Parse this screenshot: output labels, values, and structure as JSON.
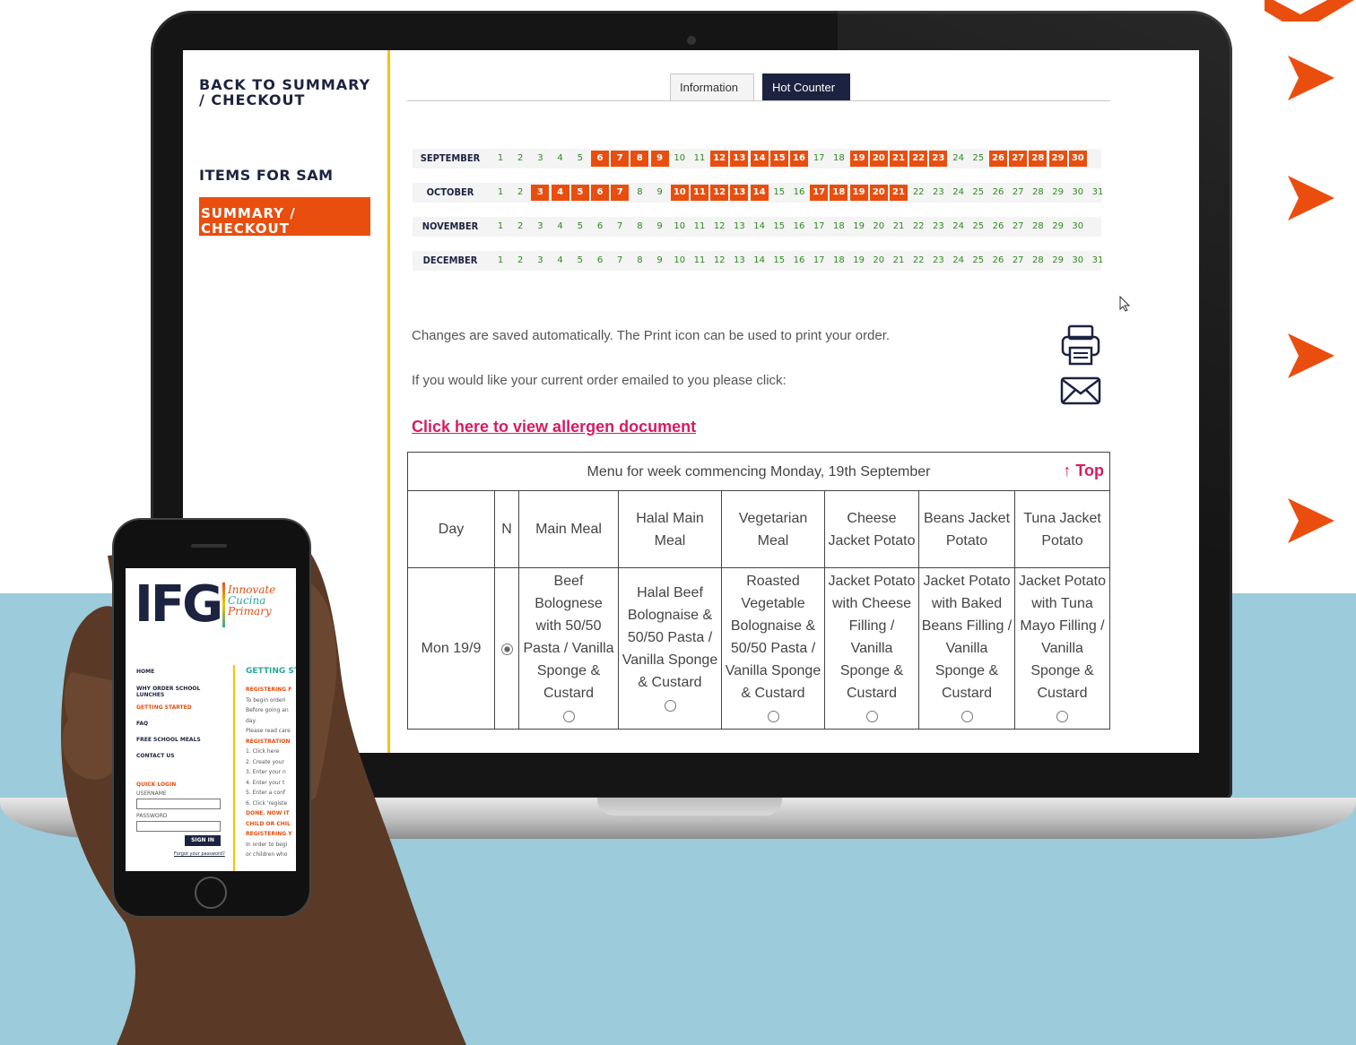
{
  "sidebar": {
    "back_link": "BACK TO SUMMARY / CHECKOUT",
    "items_title": "ITEMS FOR SAM",
    "summary_button": "SUMMARY / CHECKOUT"
  },
  "tabs": [
    {
      "label": "Information",
      "active": false
    },
    {
      "label": "Hot Counter",
      "active": true
    }
  ],
  "calendar": [
    {
      "month": "SEPTEMBER",
      "days": 30,
      "selected": [
        6,
        7,
        8,
        9,
        12,
        13,
        14,
        15,
        16,
        19,
        20,
        21,
        22,
        23,
        26,
        27,
        28,
        29,
        30
      ]
    },
    {
      "month": "OCTOBER",
      "days": 31,
      "selected": [
        3,
        4,
        5,
        6,
        7,
        10,
        11,
        12,
        13,
        14,
        17,
        18,
        19,
        20,
        21
      ]
    },
    {
      "month": "NOVEMBER",
      "days": 30,
      "selected": []
    },
    {
      "month": "DECEMBER",
      "days": 31,
      "selected": []
    }
  ],
  "info": {
    "saved_text": "Changes are saved automatically. The Print icon can be used to print your order.",
    "email_text": "If you would like your current order emailed to you please click:",
    "allergen_link": "Click here to view allergen document"
  },
  "menu": {
    "caption": "Menu for week commencing Monday, 19th September",
    "top_link": "↑ Top",
    "columns": [
      "Day",
      "N",
      "Main Meal",
      "Halal Main Meal",
      "Vegetarian Meal",
      "Cheese Jacket Potato",
      "Beans Jacket Potato",
      "Tuna Jacket Potato"
    ],
    "rows": [
      {
        "day": "Mon 19/9",
        "meals": [
          "Beef Bolognese with 50/50 Pasta / Vanilla Sponge & Custard",
          "Halal Beef Bolognaise & 50/50 Pasta / Vanilla Sponge & Custard",
          "Roasted Vegetable Bolognaise & 50/50 Pasta / Vanilla Sponge & Custard",
          "Jacket Potato with Cheese Filling / Vanilla Sponge & Custard",
          "Jacket Potato with Baked Beans Filling / Vanilla Sponge & Custard",
          "Jacket Potato with Tuna Mayo Filling / Vanilla Sponge & Custard"
        ]
      }
    ]
  },
  "phone": {
    "logo": "IFG",
    "tagline": [
      "Innovate",
      "Cucina",
      "Primary"
    ],
    "nav": [
      "HOME",
      "WHY ORDER SCHOOL LUNCHES",
      "GETTING STARTED",
      "FAQ",
      "FREE SCHOOL MEALS",
      "CONTACT US"
    ],
    "quick_login": "QUICK LOGIN",
    "username_label": "USERNAME",
    "password_label": "PASSWORD",
    "sign_in": "SIGN IN",
    "forgot": "Forgot your password?",
    "right_heading": "GETTING ST",
    "right_lines": [
      "REGISTERING F",
      "To begin orderi",
      "Before going an",
      "day.",
      "Please read care",
      "REGISTRATION",
      "1. Click here",
      "2. Create your",
      "3. Enter your n",
      "4. Enter your t",
      "5. Enter a conf",
      "6. Click 'registe",
      "DONE. NOW IT",
      "CHILD OR CHIL",
      "REGISTERING Y",
      "In order to begi",
      "or children who"
    ]
  },
  "colors": {
    "accent": "#e94e0f",
    "navy": "#1c2340",
    "yellow": "#f5c400",
    "green": "#2e8b1e",
    "pink": "#d81b60",
    "blue_bg": "#9ccbdc"
  }
}
